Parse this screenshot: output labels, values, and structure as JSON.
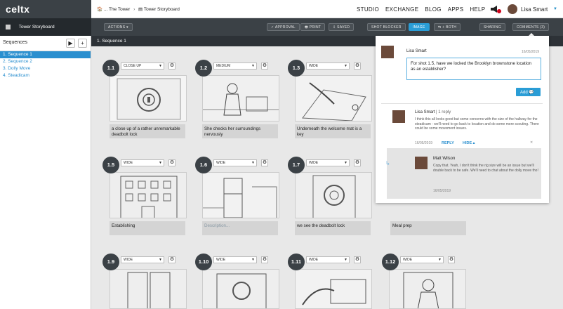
{
  "app": {
    "logo": "celtx"
  },
  "breadcrumb": {
    "root": "... The Tower",
    "current": "Tower Storyboard"
  },
  "nav": [
    "STUDIO",
    "EXCHANGE",
    "BLOG",
    "APPS",
    "HELP"
  ],
  "user": {
    "name": "Lisa Smart"
  },
  "sidebar": {
    "doc_title": "Tower Storyboard",
    "header": "Sequences",
    "items": [
      "1. Sequence 1",
      "2. Sequence 2",
      "3. Dolly Move",
      "4. Steadicam"
    ]
  },
  "toolbar": {
    "actions": "ACTIONS ▾",
    "approval": "✓ APPROVAL",
    "print": "🖶 PRINT",
    "saved": "⇩ SAVED",
    "shot_blocker": "SHOT BLOCKER",
    "image": "IMAGE",
    "both": "⇆ + BOTH",
    "sharing": "SHARING",
    "comments": "COMMENTS (3)"
  },
  "main": {
    "sequence_title": "1. Sequence 1"
  },
  "shots": [
    {
      "num": "1.1",
      "type": "CLOSE UP",
      "desc": "a close up of a rather unremarkable deadbolt lock"
    },
    {
      "num": "1.2",
      "type": "MEDIUM",
      "desc": "She checks her surroundings nervously"
    },
    {
      "num": "1.3",
      "type": "WIDE",
      "desc": "Underneath the welcome mat is a key"
    },
    {
      "num": "1.5",
      "type": "WIDE",
      "desc": "Establishing"
    },
    {
      "num": "1.6",
      "type": "WIDE",
      "placeholder": "Description..."
    },
    {
      "num": "1.7",
      "type": "WIDE",
      "desc": "we see the deadbolt lock"
    },
    {
      "num": "",
      "type": "",
      "desc": "Meal prep"
    },
    {
      "num": "1.9",
      "type": "WIDE"
    },
    {
      "num": "1.10",
      "type": "WIDE"
    },
    {
      "num": "1.11",
      "type": "WIDE"
    },
    {
      "num": "1.12",
      "type": "WIDE"
    }
  ],
  "comments": {
    "new_author": "Lisa Smart",
    "new_date": "16/05/2019",
    "draft": "For shot 1.5, have we locked the Brooklyn brownstone location as an establisher?",
    "add_label": "Add 💬",
    "thread": {
      "author": "Lisa Smart",
      "reply_count": "| 1 reply",
      "text": "I think this all looks good but some concerns with the size of the hallway for the steadicam - we'll need to go back to location and do some more scouting. There could be some movement issues.",
      "date": "16/05/2019",
      "reply_action": "REPLY",
      "hide_action": "HIDE ▴"
    },
    "reply": {
      "author": "Matt Wilson",
      "text": "Copy that. Yeah, I don't think the rig size will be an issue but we'll double back to be safe. We'll need to chat about the dolly move tho!",
      "date": "16/05/2019"
    }
  },
  "colors": {
    "accent": "#2a9dd6",
    "dark": "#3b4146",
    "sidebar_active": "#2a8fcf"
  }
}
